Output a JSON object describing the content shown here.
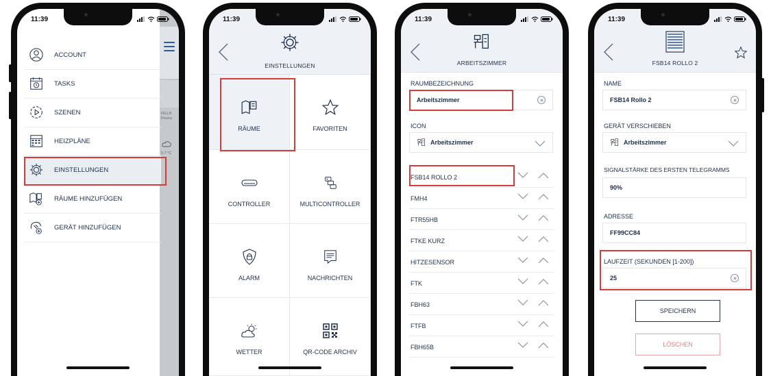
{
  "status": {
    "time": "11:39"
  },
  "screen1": {
    "menu": [
      {
        "label": "ACCOUNT",
        "icon": "account-icon"
      },
      {
        "label": "TASKS",
        "icon": "tasks-icon"
      },
      {
        "label": "SZENEN",
        "icon": "scenes-icon"
      },
      {
        "label": "HEIZPLÄNE",
        "icon": "heating-plan-icon"
      },
      {
        "label": "EINSTELLUNGEN",
        "icon": "gear-icon",
        "selected": true
      },
      {
        "label": "RÄUME HINZUFÜGEN",
        "icon": "add-room-icon"
      },
      {
        "label": "GERÄT HINZUFÜGEN",
        "icon": "add-device-icon"
      }
    ],
    "background": {
      "card_title": "FELLB",
      "card_subtitle": "Povera",
      "temp": "5.7 °C"
    }
  },
  "screen2": {
    "title": "EINSTELLUNGEN",
    "tiles": [
      {
        "label": "RÄUME",
        "icon": "rooms-icon",
        "selected": true
      },
      {
        "label": "FAVORITEN",
        "icon": "star-icon"
      },
      {
        "label": "CONTROLLER",
        "icon": "controller-icon"
      },
      {
        "label": "MULTICONTROLLER",
        "icon": "multicontroller-icon"
      },
      {
        "label": "ALARM",
        "icon": "shield-lock-icon"
      },
      {
        "label": "NACHRICHTEN",
        "icon": "message-icon"
      },
      {
        "label": "WETTER",
        "icon": "weather-icon"
      },
      {
        "label": "QR-CODE ARCHIV",
        "icon": "qr-code-icon"
      }
    ]
  },
  "screen3": {
    "title": "ARBEITSZIMMER",
    "room_label": "RAUMBEZEICHNUNG",
    "room_value": "Arbeitszimmer",
    "icon_label": "ICON",
    "icon_value": "Arbeitszimmer",
    "devices": [
      "FSB14 ROLLO 2",
      "FMH4",
      "FTR55HB",
      "FTKE KURZ",
      "HITZESENSOR",
      "FTK",
      "FBH63",
      "FTFB",
      "FBH65B"
    ]
  },
  "screen4": {
    "title": "FSB14 ROLLO 2",
    "name_label": "NAME",
    "name_value": "FSB14 Rollo 2",
    "move_label": "GERÄT VERSCHIEBEN",
    "move_value": "Arbeitszimmer",
    "signal_label": "SIGNALSTÄRKE DES ERSTEN TELEGRAMMS",
    "signal_value": "90%",
    "address_label": "ADRESSE",
    "address_value": "FF99CC84",
    "runtime_label": "LAUFZEIT (SEKUNDEN [1-200])",
    "runtime_value": "25",
    "save_label": "SPEICHERN",
    "delete_label": "LÖSCHEN"
  },
  "colors": {
    "text": "#1e2f4a",
    "header_bg": "#eef2f6",
    "highlight": "#d83a3a",
    "accent": "#2a5aa8",
    "delete": "#e07f7f"
  }
}
